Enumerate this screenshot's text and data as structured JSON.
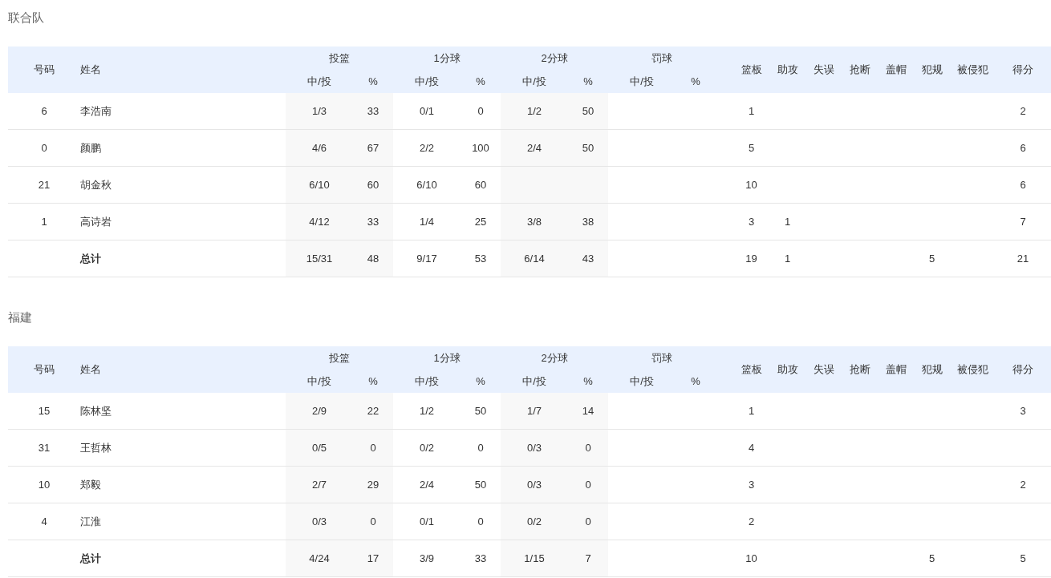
{
  "teams": [
    {
      "name": "联合队",
      "header": {
        "number": "号码",
        "player": "姓名",
        "groups": [
          {
            "label": "投篮",
            "made_label": "中/投",
            "pct_label": "%"
          },
          {
            "label": "1分球",
            "made_label": "中/投",
            "pct_label": "%"
          },
          {
            "label": "2分球",
            "made_label": "中/投",
            "pct_label": "%"
          },
          {
            "label": "罚球",
            "made_label": "中/投",
            "pct_label": "%"
          }
        ],
        "stats": [
          "篮板",
          "助攻",
          "失误",
          "抢断",
          "盖帽",
          "犯规",
          "被侵犯",
          "得分"
        ]
      },
      "rows": [
        {
          "kind": "player",
          "number": "6",
          "player": "李浩南",
          "field_goals": {
            "made": "1/3",
            "pct": "33"
          },
          "one_pointers": {
            "made": "0/1",
            "pct": "0"
          },
          "two_pointers": {
            "made": "1/2",
            "pct": "50"
          },
          "rebounds": "1",
          "points": "2"
        },
        {
          "kind": "player",
          "number": "0",
          "player": "颜鹏",
          "field_goals": {
            "made": "4/6",
            "pct": "67"
          },
          "one_pointers": {
            "made": "2/2",
            "pct": "100"
          },
          "two_pointers": {
            "made": "2/4",
            "pct": "50"
          },
          "rebounds": "5",
          "points": "6"
        },
        {
          "kind": "player",
          "number": "21",
          "player": "胡金秋",
          "field_goals": {
            "made": "6/10",
            "pct": "60"
          },
          "one_pointers": {
            "made": "6/10",
            "pct": "60"
          },
          "rebounds": "10",
          "points": "6"
        },
        {
          "kind": "player",
          "number": "1",
          "player": "高诗岩",
          "field_goals": {
            "made": "4/12",
            "pct": "33"
          },
          "one_pointers": {
            "made": "1/4",
            "pct": "25"
          },
          "two_pointers": {
            "made": "3/8",
            "pct": "38"
          },
          "rebounds": "3",
          "assists": "1",
          "points": "7"
        },
        {
          "kind": "total",
          "player": "总计",
          "field_goals": {
            "made": "15/31",
            "pct": "48"
          },
          "one_pointers": {
            "made": "9/17",
            "pct": "53"
          },
          "two_pointers": {
            "made": "6/14",
            "pct": "43"
          },
          "rebounds": "19",
          "assists": "1",
          "fouls": "5",
          "points": "21"
        }
      ]
    },
    {
      "name": "福建",
      "header": {
        "number": "号码",
        "player": "姓名",
        "groups": [
          {
            "label": "投篮",
            "made_label": "中/投",
            "pct_label": "%"
          },
          {
            "label": "1分球",
            "made_label": "中/投",
            "pct_label": "%"
          },
          {
            "label": "2分球",
            "made_label": "中/投",
            "pct_label": "%"
          },
          {
            "label": "罚球",
            "made_label": "中/投",
            "pct_label": "%"
          }
        ],
        "stats": [
          "篮板",
          "助攻",
          "失误",
          "抢断",
          "盖帽",
          "犯规",
          "被侵犯",
          "得分"
        ]
      },
      "rows": [
        {
          "kind": "player",
          "number": "15",
          "player": "陈林坚",
          "field_goals": {
            "made": "2/9",
            "pct": "22"
          },
          "one_pointers": {
            "made": "1/2",
            "pct": "50"
          },
          "two_pointers": {
            "made": "1/7",
            "pct": "14"
          },
          "rebounds": "1",
          "points": "3"
        },
        {
          "kind": "player",
          "number": "31",
          "player": "王哲林",
          "field_goals": {
            "made": "0/5",
            "pct": "0"
          },
          "one_pointers": {
            "made": "0/2",
            "pct": "0"
          },
          "two_pointers": {
            "made": "0/3",
            "pct": "0"
          },
          "rebounds": "4"
        },
        {
          "kind": "player",
          "number": "10",
          "player": "郑毅",
          "field_goals": {
            "made": "2/7",
            "pct": "29"
          },
          "one_pointers": {
            "made": "2/4",
            "pct": "50"
          },
          "two_pointers": {
            "made": "0/3",
            "pct": "0"
          },
          "rebounds": "3",
          "points": "2"
        },
        {
          "kind": "player",
          "number": "4",
          "player": "江淮",
          "field_goals": {
            "made": "0/3",
            "pct": "0"
          },
          "one_pointers": {
            "made": "0/1",
            "pct": "0"
          },
          "two_pointers": {
            "made": "0/2",
            "pct": "0"
          },
          "rebounds": "2"
        },
        {
          "kind": "total",
          "player": "总计",
          "field_goals": {
            "made": "4/24",
            "pct": "17"
          },
          "one_pointers": {
            "made": "3/9",
            "pct": "33"
          },
          "two_pointers": {
            "made": "1/15",
            "pct": "7"
          },
          "rebounds": "10",
          "fouls": "5",
          "points": "5"
        }
      ]
    }
  ]
}
